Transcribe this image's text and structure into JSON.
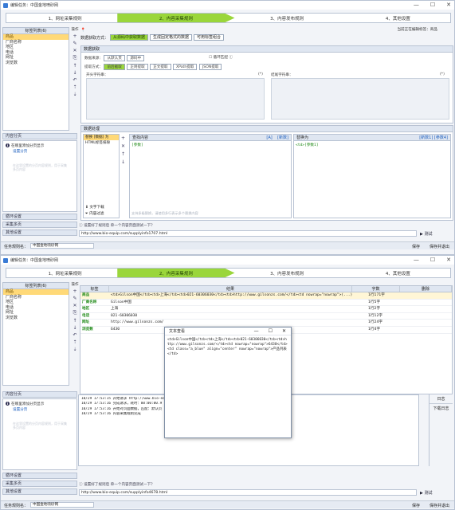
{
  "window_title": "编辑任务：中国金地喷砂网",
  "title_buttons": {
    "min": "—",
    "max": "☐",
    "close": "✕"
  },
  "steps": [
    "1、网址采集规则",
    "2、内容采集规则",
    "3、内容发布规则",
    "4、其他设置"
  ],
  "active_step": 1,
  "left_panel": {
    "header": "标签列表(6)",
    "ops_label": "操作",
    "items": [
      "商品",
      "厂商名称",
      "地区",
      "电话",
      "网址",
      "浏览数"
    ],
    "selected": 0
  },
  "left_sections": {
    "content_paging": "内容分页",
    "paging_hint": "在哪里添加分页显示",
    "paging_link": "设置分页",
    "paging_ghost": "在这里设置的分页内容规则，用于采集多页内容",
    "loop_settings": "循环设置",
    "more_pages": "采集多页",
    "other_settings": "其他设置"
  },
  "w1": {
    "label_name_prefix": "当前正在编辑标签：",
    "label_name": "商品",
    "data_source_label": "数据获取方式：",
    "modes": [
      "从源码中获取数据",
      "生成固定格式的数据",
      "可用标签组合"
    ],
    "data_fetch_header": "数据获取",
    "source_label": "数据来源：",
    "source_tags": [
      "从默认页",
      "源码中"
    ],
    "loop_match": "循环匹配",
    "extract_label": "提取方式：",
    "extract_tabs": [
      "前后截取",
      "正则提取",
      "正文提取",
      "XPath提取",
      "JSON提取"
    ],
    "start_string_label": "开头字符串：",
    "start_string_hint": "(*)",
    "end_string_label": "结尾字符串：",
    "end_string_hint": "(*)",
    "processing_header": "数据处理",
    "proc_item_1": "替换 [数据] 为",
    "proc_item_2": "HTML标签排除",
    "proc_footer_1": "文字下载",
    "proc_footer_2": "内容过滤",
    "find_header": "查找内容",
    "find_links": [
      "[A]",
      "[新数]"
    ],
    "find_value": "[参数]",
    "replace_header": "替换为",
    "replace_links": [
      "[新数1]",
      "[参数4]"
    ],
    "replace_value": "<td>[参数1]",
    "replace_hint": "支持多级替换，请使用多行表示多个替换内容",
    "tip": "设置好了规则后 单一个内容页面测试一下？",
    "test_url": "http://www.bio-equip.com/supplyinfo1707.html",
    "test_button": "测试"
  },
  "w2": {
    "columns": [
      "标签",
      "结果",
      "字数",
      "删除"
    ],
    "rows": [
      {
        "tag": "商品",
        "result": "<td>Gilson中国</td><td>上海</td><td>021-60306030</td><td>http://www.gilsonzs.com/</td><td nowrap=\"nowrap\">(...)",
        "count": "1行171字"
      },
      {
        "tag": "厂商名称",
        "result": "Gilson中国",
        "count": "1行5字"
      },
      {
        "tag": "地区",
        "result": "上海",
        "count": "1行2字"
      },
      {
        "tag": "电话",
        "result": "021-60306030",
        "count": "1行12字"
      },
      {
        "tag": "网址",
        "result": "http://www.gilsonzs.com/",
        "count": "1行24字"
      },
      {
        "tag": "浏览数",
        "result": "6430",
        "count": "1行4字"
      }
    ],
    "log": [
      "10/29 17:53:15 开始请求 http://www.bio-equip.com/supplyinfo4678.html",
      "10/29 17:53:16 完成请求，耗时：00:00:00.9",
      "10/29 17:53:16 开始对页面数据，匹配：默认页",
      "10/29 17:53:16 内容采集规则完成"
    ],
    "log_side": [
      "日志",
      "下载日志"
    ],
    "test_url": "http://www.bio-equip.com/supplyinfo4678.html",
    "tip": "设置好了规则后 单一个内容页面测试一下？",
    "test_button": "测试"
  },
  "dialog": {
    "title": "文本查看",
    "content": "<td>Gilson中国</td><td>上海</td><td>021-60306030</td><td>http://www.gilsonzs.com/</td><td nowrap=\"nowrap\">6430</td><td class=\"a_blue\" align=\"center\" nowrap=\"nowrap\">产品列表</td>"
  },
  "footer": {
    "task_name_label": "任务规则名：",
    "task_name": "中国金地喷砂网",
    "save": "保存",
    "save_exit": "保存并退出"
  }
}
